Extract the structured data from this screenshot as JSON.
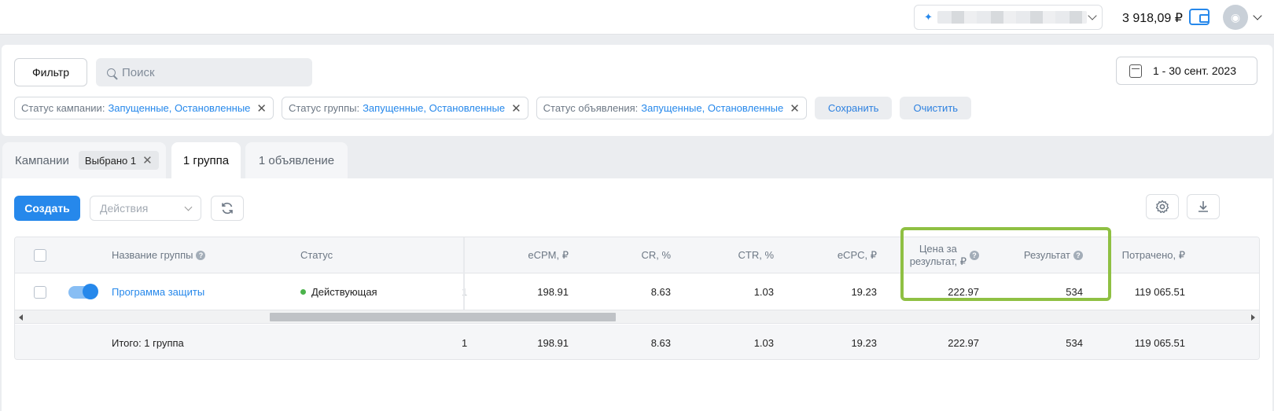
{
  "topbar": {
    "balance": "3 918,09 ₽",
    "account_icon": "sparkle-icon",
    "wallet_icon": "wallet-icon",
    "avatar_icon": "camera-icon"
  },
  "filters": {
    "filter_label": "Фильтр",
    "search_placeholder": "Поиск",
    "date_range": "1 - 30 сент. 2023",
    "chips": [
      {
        "key": "Статус кампании:",
        "value": "Запущенные, Остановленные"
      },
      {
        "key": "Статус группы:",
        "value": "Запущенные, Остановленные"
      },
      {
        "key": "Статус объявления:",
        "value": "Запущенные, Остановленные"
      }
    ],
    "save_label": "Сохранить",
    "clear_label": "Очистить"
  },
  "tabs": {
    "campaigns": "Кампании",
    "selected_badge": "Выбрано 1",
    "groups": "1 группа",
    "ads": "1 объявление"
  },
  "toolbar": {
    "create_label": "Создать",
    "actions_placeholder": "Действия"
  },
  "table": {
    "headers": {
      "name": "Название группы",
      "status": "Статус",
      "ecpm": "eCPM, ₽",
      "cr": "CR, %",
      "ctr": "CTR, %",
      "ecpc": "eCPC, ₽",
      "cpr_line1": "Цена за",
      "cpr_line2": "результат, ₽",
      "result": "Результат",
      "spent": "Потрачено, ₽"
    },
    "row": {
      "name": "Программа защиты",
      "status": "Действующая",
      "hidden_col": "1",
      "ecpm": "198.91",
      "cr": "8.63",
      "ctr": "1.03",
      "ecpc": "19.23",
      "cpr": "222.97",
      "result": "534",
      "spent": "119 065.51"
    },
    "total": {
      "label": "Итого: 1 группа",
      "hidden_col": "1",
      "ecpm": "198.91",
      "cr": "8.63",
      "ctr": "1.03",
      "ecpc": "19.23",
      "cpr": "222.97",
      "result": "534",
      "spent": "119 065.51"
    }
  },
  "colors": {
    "accent": "#2688eb",
    "status_active": "#4bb34b",
    "highlight": "#8fc043"
  }
}
